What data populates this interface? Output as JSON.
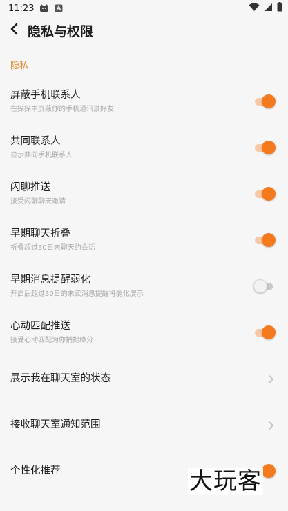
{
  "status_bar": {
    "time": "11:23",
    "icons": [
      "cat-app-icon",
      "a-app-icon",
      "wifi-icon",
      "signal-icon",
      "battery-icon"
    ]
  },
  "header": {
    "back_icon": "chevron-left-icon",
    "title": "隐私与权限"
  },
  "section": {
    "title": "隐私"
  },
  "items": [
    {
      "title": "屏蔽手机联系人",
      "subtitle": "在探探中屏蔽你的手机通讯录好友",
      "control": "toggle",
      "on": true
    },
    {
      "title": "共同联系人",
      "subtitle": "显示共同手机联系人",
      "control": "toggle",
      "on": true
    },
    {
      "title": "闪聊推送",
      "subtitle": "接受闪聊聊天邀请",
      "control": "toggle",
      "on": true
    },
    {
      "title": "早期聊天折叠",
      "subtitle": "折叠超过30日未聊天的会话",
      "control": "toggle",
      "on": true
    },
    {
      "title": "早期消息提醒弱化",
      "subtitle": "开启后超过30日的未读消息提醒将弱化展示",
      "control": "toggle",
      "on": false
    },
    {
      "title": "心动匹配推送",
      "subtitle": "接受心动匹配为你捕捉缘分",
      "control": "toggle",
      "on": true
    },
    {
      "title": "展示我在聊天室的状态",
      "subtitle": "",
      "control": "chevron"
    },
    {
      "title": "接收聊天室通知范围",
      "subtitle": "",
      "control": "chevron"
    },
    {
      "title": "个性化推荐",
      "subtitle": "",
      "control": "toggle",
      "on": true
    }
  ],
  "watermark": {
    "text": "大玩客"
  },
  "colors": {
    "accent": "#f57a1e",
    "accent_track": "#f8c8a4",
    "section_title": "#e4882a",
    "background": "#f6f6f6"
  }
}
